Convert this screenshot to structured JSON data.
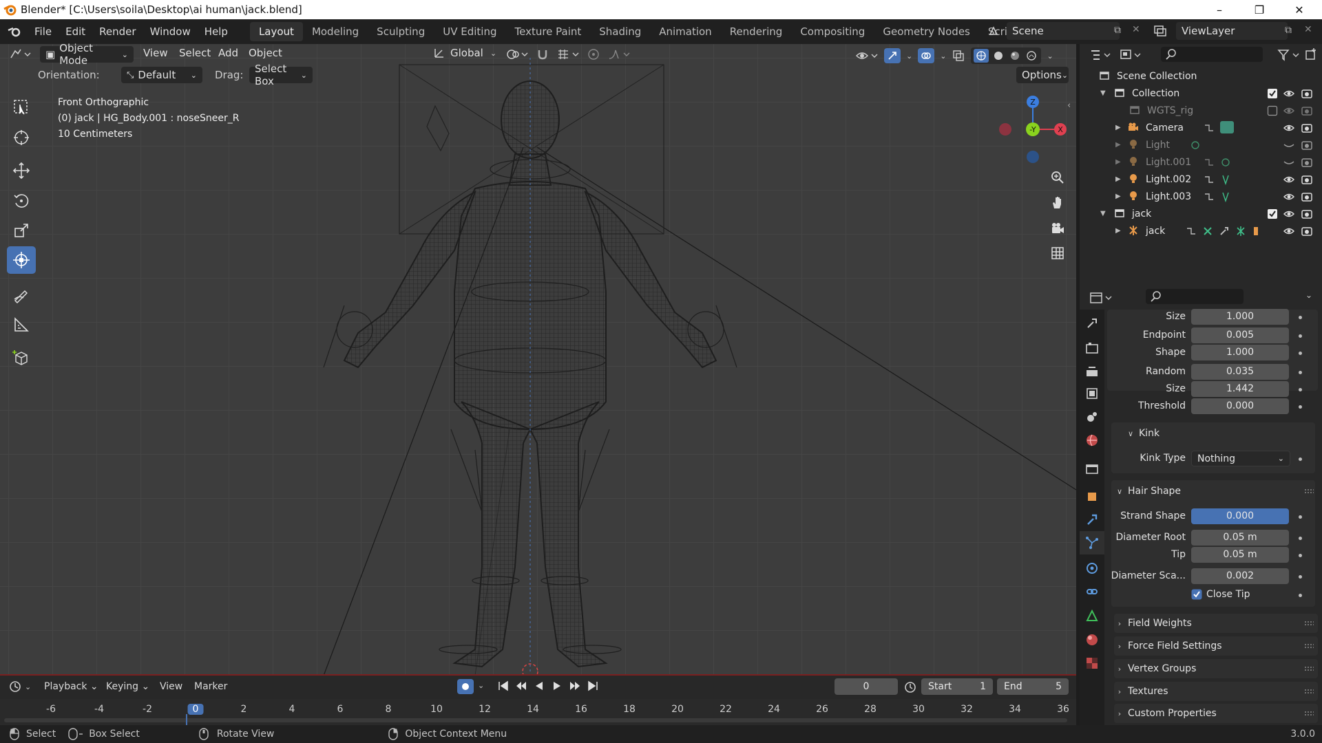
{
  "window": {
    "title": "Blender* [C:\\Users\\soila\\Desktop\\ai human\\jack.blend]",
    "controls": [
      "–",
      "❐",
      "✕"
    ]
  },
  "menubar": {
    "items": [
      "File",
      "Edit",
      "Render",
      "Window",
      "Help"
    ],
    "workspaces": [
      "Layout",
      "Modeling",
      "Sculpting",
      "UV Editing",
      "Texture Paint",
      "Shading",
      "Animation",
      "Rendering",
      "Compositing",
      "Geometry Nodes",
      "Scripting"
    ],
    "active_workspace": "Layout",
    "add_tab": "+",
    "scene": "Scene",
    "view_layer": "ViewLayer"
  },
  "viewport_header": {
    "mode": "Object Mode",
    "menus": [
      "View",
      "Select",
      "Add",
      "Object"
    ],
    "transform_orientation": "Global"
  },
  "tool_settings": {
    "orientation_label": "Orientation:",
    "orientation_value": "Default",
    "drag_label": "Drag:",
    "drag_value": "Select Box",
    "options": "Options"
  },
  "viewport_overlay": {
    "view_name": "Front Orthographic",
    "object_info": "(0) jack | HG_Body.001 : noseSneer_R",
    "scale": "10 Centimeters"
  },
  "gizmo": {
    "z": "Z",
    "y": "-Y",
    "x": "X"
  },
  "outliner": {
    "scene_collection": "Scene Collection",
    "rows": [
      {
        "label": "Collection",
        "dim": false
      },
      {
        "label": "WGTS_rig",
        "dim": true
      },
      {
        "label": "Camera",
        "dim": false
      },
      {
        "label": "Light",
        "dim": true
      },
      {
        "label": "Light.001",
        "dim": true
      },
      {
        "label": "Light.002",
        "dim": false
      },
      {
        "label": "Light.003",
        "dim": false
      },
      {
        "label": "jack",
        "dim": false
      },
      {
        "label": "jack",
        "dim": false
      }
    ]
  },
  "properties": {
    "fields": [
      {
        "label": "Size",
        "value": "1.000"
      },
      {
        "label": "Endpoint",
        "value": "0.005"
      },
      {
        "label": "Shape",
        "value": "1.000"
      },
      {
        "label": "Random",
        "value": "0.035"
      },
      {
        "label": "Size",
        "value": "1.442"
      },
      {
        "label": "Threshold",
        "value": "0.000"
      }
    ],
    "kink": {
      "header": "Kink",
      "type_label": "Kink Type",
      "type_value": "Nothing"
    },
    "hair_shape": {
      "header": "Hair Shape",
      "strand_shape_label": "Strand Shape",
      "strand_shape_value": "0.000",
      "diameter_root_label": "Diameter Root",
      "diameter_root_value": "0.05 m",
      "tip_label": "Tip",
      "tip_value": "0.05 m",
      "diameter_scale_label": "Diameter Sca...",
      "diameter_scale_value": "0.002",
      "close_tip_label": "Close Tip",
      "close_tip_checked": true
    },
    "collapsed_panels": [
      "Field Weights",
      "Force Field Settings",
      "Vertex Groups",
      "Textures",
      "Custom Properties"
    ]
  },
  "timeline": {
    "menus": [
      "Playback",
      "Keying",
      "View",
      "Marker"
    ],
    "current_frame": "0",
    "start_label": "Start",
    "start_value": "1",
    "end_label": "End",
    "end_value": "5",
    "ruler": [
      "-6",
      "-4",
      "-2",
      "0",
      "2",
      "4",
      "6",
      "8",
      "10",
      "12",
      "14",
      "16",
      "18",
      "20",
      "22",
      "24",
      "26",
      "28",
      "30",
      "32",
      "34",
      "36"
    ]
  },
  "statusbar": {
    "select": "Select",
    "box_select": "Box Select",
    "rotate_view": "Rotate View",
    "context_menu": "Object Context Menu",
    "version": "3.0.0"
  },
  "colors": {
    "accent": "#4772b3",
    "viewport_bg": "#3d3d3d",
    "panel_bg": "#282828",
    "axis_x": "#e04050",
    "axis_y": "#8ad21e",
    "axis_z": "#3b7ee0"
  }
}
